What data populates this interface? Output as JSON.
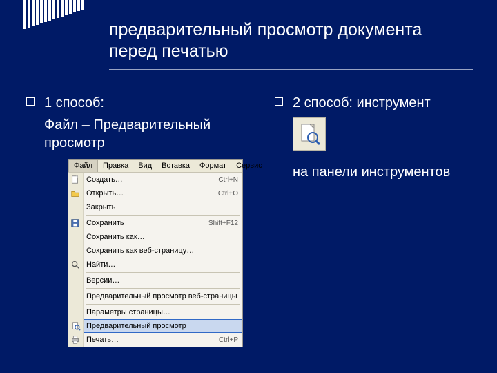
{
  "title": "предварительный просмотр документа перед печатью",
  "left": {
    "bullet": "1 способ:",
    "line2": "Файл – Предварительный просмотр"
  },
  "right": {
    "bullet": "2 способ: инструмент",
    "line2": "на панели инструментов"
  },
  "menu": {
    "bar": [
      "Файл",
      "Правка",
      "Вид",
      "Вставка",
      "Формат",
      "Сервис"
    ],
    "items": [
      {
        "label": "Создать…",
        "shortcut": "Ctrl+N",
        "icon": "new"
      },
      {
        "label": "Открыть…",
        "shortcut": "Ctrl+O",
        "icon": "open"
      },
      {
        "label": "Закрыть",
        "shortcut": "",
        "icon": ""
      },
      {
        "sep": true
      },
      {
        "label": "Сохранить",
        "shortcut": "Shift+F12",
        "icon": "save"
      },
      {
        "label": "Сохранить как…",
        "shortcut": "",
        "icon": ""
      },
      {
        "label": "Сохранить как веб-страницу…",
        "shortcut": "",
        "icon": ""
      },
      {
        "label": "Найти…",
        "shortcut": "",
        "icon": "find"
      },
      {
        "sep": true
      },
      {
        "label": "Версии…",
        "shortcut": "",
        "icon": ""
      },
      {
        "sep": true
      },
      {
        "label": "Предварительный просмотр веб-страницы",
        "shortcut": "",
        "icon": ""
      },
      {
        "sep": true
      },
      {
        "label": "Параметры страницы…",
        "shortcut": "",
        "icon": ""
      },
      {
        "label": "Предварительный просмотр",
        "shortcut": "",
        "icon": "preview",
        "hl": true
      },
      {
        "label": "Печать…",
        "shortcut": "Ctrl+P",
        "icon": "print"
      }
    ]
  }
}
